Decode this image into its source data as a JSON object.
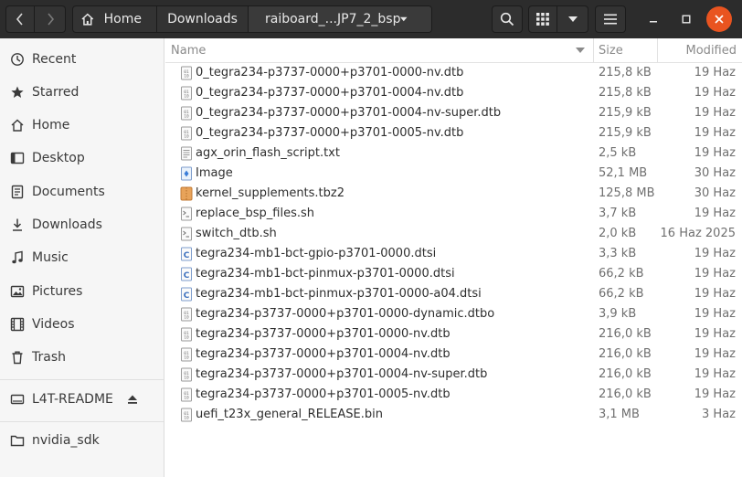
{
  "header": {
    "path": [
      {
        "label": "Home"
      },
      {
        "label": "Downloads"
      },
      {
        "label": "raiboard_...JP7_2_bsp"
      }
    ]
  },
  "sidebar": {
    "items": [
      {
        "label": "Recent",
        "icon": "clock-icon"
      },
      {
        "label": "Starred",
        "icon": "star-icon"
      },
      {
        "label": "Home",
        "icon": "home-icon"
      },
      {
        "label": "Desktop",
        "icon": "desktop-icon"
      },
      {
        "label": "Documents",
        "icon": "document-icon"
      },
      {
        "label": "Downloads",
        "icon": "download-icon"
      },
      {
        "label": "Music",
        "icon": "music-icon"
      },
      {
        "label": "Pictures",
        "icon": "picture-icon"
      },
      {
        "label": "Videos",
        "icon": "video-icon"
      },
      {
        "label": "Trash",
        "icon": "trash-icon"
      }
    ],
    "devices": [
      {
        "label": "L4T-README",
        "icon": "drive-icon"
      }
    ],
    "bookmarks": [
      {
        "label": "nvidia_sdk",
        "icon": "folder-icon"
      }
    ]
  },
  "columns": {
    "name": "Name",
    "size": "Size",
    "modified": "Modified"
  },
  "files": [
    {
      "name": "0_tegra234-p3737-0000+p3701-0000-nv.dtb",
      "size": "215,8 kB",
      "modified": "19 Haz",
      "type": "binary"
    },
    {
      "name": "0_tegra234-p3737-0000+p3701-0004-nv.dtb",
      "size": "215,8 kB",
      "modified": "19 Haz",
      "type": "binary"
    },
    {
      "name": "0_tegra234-p3737-0000+p3701-0004-nv-super.dtb",
      "size": "215,9 kB",
      "modified": "19 Haz",
      "type": "binary"
    },
    {
      "name": "0_tegra234-p3737-0000+p3701-0005-nv.dtb",
      "size": "215,9 kB",
      "modified": "19 Haz",
      "type": "binary"
    },
    {
      "name": "agx_orin_flash_script.txt",
      "size": "2,5 kB",
      "modified": "19 Haz",
      "type": "text"
    },
    {
      "name": "Image",
      "size": "52,1 MB",
      "modified": "30 Haz",
      "type": "image"
    },
    {
      "name": "kernel_supplements.tbz2",
      "size": "125,8 MB",
      "modified": "30 Haz",
      "type": "archive"
    },
    {
      "name": "replace_bsp_files.sh",
      "size": "3,7 kB",
      "modified": "19 Haz",
      "type": "script"
    },
    {
      "name": "switch_dtb.sh",
      "size": "2,0 kB",
      "modified": "16 Haz 2025",
      "type": "script"
    },
    {
      "name": "tegra234-mb1-bct-gpio-p3701-0000.dtsi",
      "size": "3,3 kB",
      "modified": "19 Haz",
      "type": "csource"
    },
    {
      "name": "tegra234-mb1-bct-pinmux-p3701-0000.dtsi",
      "size": "66,2 kB",
      "modified": "19 Haz",
      "type": "csource"
    },
    {
      "name": "tegra234-mb1-bct-pinmux-p3701-0000-a04.dtsi",
      "size": "66,2 kB",
      "modified": "19 Haz",
      "type": "csource"
    },
    {
      "name": "tegra234-p3737-0000+p3701-0000-dynamic.dtbo",
      "size": "3,9 kB",
      "modified": "19 Haz",
      "type": "binary"
    },
    {
      "name": "tegra234-p3737-0000+p3701-0000-nv.dtb",
      "size": "216,0 kB",
      "modified": "19 Haz",
      "type": "binary"
    },
    {
      "name": "tegra234-p3737-0000+p3701-0004-nv.dtb",
      "size": "216,0 kB",
      "modified": "19 Haz",
      "type": "binary"
    },
    {
      "name": "tegra234-p3737-0000+p3701-0004-nv-super.dtb",
      "size": "216,0 kB",
      "modified": "19 Haz",
      "type": "binary"
    },
    {
      "name": "tegra234-p3737-0000+p3701-0005-nv.dtb",
      "size": "216,0 kB",
      "modified": "19 Haz",
      "type": "binary"
    },
    {
      "name": "uefi_t23x_general_RELEASE.bin",
      "size": "3,1 MB",
      "modified": "3 Haz",
      "type": "binary"
    }
  ],
  "colors": {
    "header": "#2c2c2c",
    "accent": "#e95420",
    "sidebar": "#f6f6f6"
  }
}
